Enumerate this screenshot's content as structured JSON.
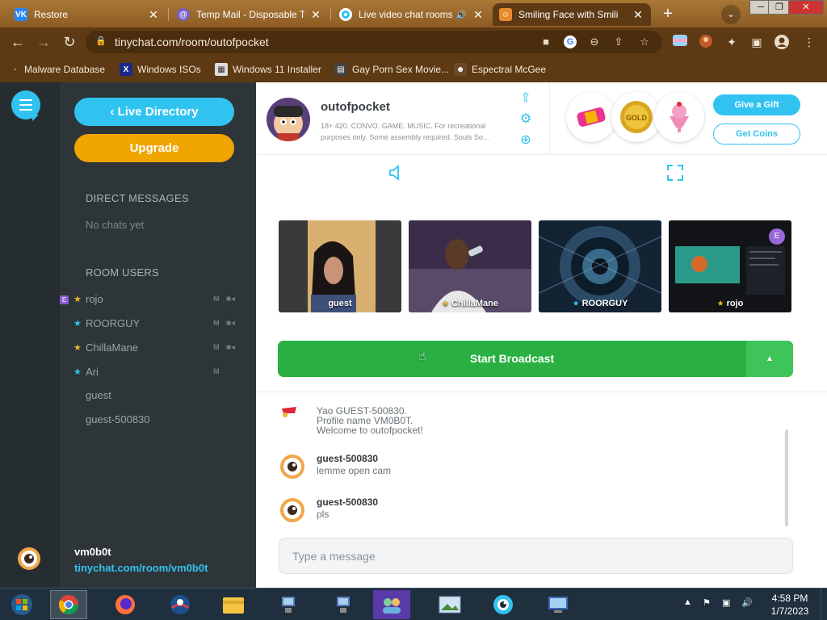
{
  "browser": {
    "tabs": [
      {
        "title": "Restore",
        "favicon": "vk",
        "color": "#2787f5"
      },
      {
        "title": "Temp Mail - Disposable Te",
        "favicon": "at",
        "color": "#7b61c9"
      },
      {
        "title": "Live video chat rooms",
        "favicon": "eye",
        "color": "#31c3f0",
        "audio": true
      },
      {
        "title": "Smiling Face with Smili",
        "favicon": "emoji",
        "color": "#e98b2a",
        "active": true
      }
    ],
    "url": "tinychat.com/room/outofpocket",
    "bookmarks": [
      "Malware Database",
      "Windows ISOs",
      "Windows 11 Installer",
      "Gay Porn Sex Movie...",
      "Espectral McGee"
    ]
  },
  "sidebar": {
    "live_directory": "Live Directory",
    "upgrade": "Upgrade",
    "dm_title": "DIRECT MESSAGES",
    "no_chats": "No chats yet",
    "room_users_title": "ROOM USERS",
    "users": [
      {
        "name": "rojo",
        "badge": "E",
        "star": "gold",
        "mic": "M",
        "cam": true
      },
      {
        "name": "ROORGUY",
        "badge": "",
        "star": "blue",
        "mic": "M",
        "cam": true
      },
      {
        "name": "ChillaMane",
        "badge": "",
        "star": "gold",
        "mic": "M",
        "cam": true
      },
      {
        "name": "Ari",
        "badge": "",
        "star": "blue",
        "mic": "M",
        "cam": false
      },
      {
        "name": "guest",
        "badge": "",
        "star": "",
        "mic": "",
        "cam": false
      },
      {
        "name": "guest-500830",
        "badge": "",
        "star": "",
        "mic": "",
        "cam": false
      }
    ],
    "me_name": "vm0b0t",
    "me_link": "tinychat.com/room/vm0b0t"
  },
  "room": {
    "name": "outofpocket",
    "description": "18+ 420. CONVO. GAME. MUSIC. For recreational purposes only. Some assembly required. Souls So...",
    "give_gift": "Give a Gift",
    "get_coins": "Get Coins"
  },
  "cams": [
    {
      "name": "guest",
      "star": ""
    },
    {
      "name": "ChillaMane",
      "star": "gold"
    },
    {
      "name": "ROORGUY",
      "star": "blue"
    },
    {
      "name": "rojo",
      "star": "gold",
      "badge": "E"
    }
  ],
  "broadcast": {
    "label": "Start Broadcast"
  },
  "chat": {
    "system_lines": [
      "Yao GUEST-500830.",
      "Profile name VM0B0T.",
      "Welcome to outofpocket!"
    ],
    "messages": [
      {
        "user": "guest-500830",
        "text": "lemme open cam"
      },
      {
        "user": "guest-500830",
        "text": "pls"
      }
    ],
    "placeholder": "Type a message"
  },
  "taskbar": {
    "time": "4:58 PM",
    "date": "1/7/2023"
  },
  "colors": {
    "accent": "#31c3f0",
    "upgrade": "#f0a500",
    "broadcast": "#2ab042",
    "sidebar": "#2e3539"
  }
}
